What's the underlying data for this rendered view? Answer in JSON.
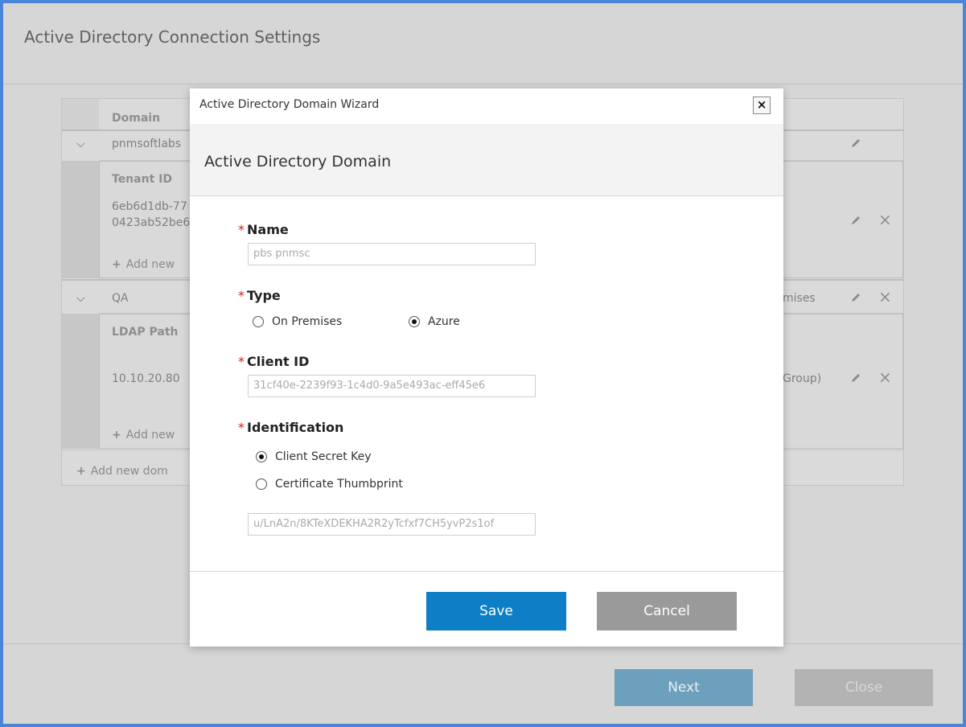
{
  "background": {
    "title": "Active Directory Connection Settings",
    "table": {
      "header_domain": "Domain",
      "row1_domain": "pnmsoftlabs",
      "row1_sub_header": "Tenant ID",
      "row1_tenant_line1": "6eb6d1db-77",
      "row1_tenant_line2": "0423ab52be6",
      "row1_add": "Add new",
      "row2_domain": "QA",
      "row2_type_partial": "mises",
      "row2_sub_header": "LDAP Path",
      "row2_ldap": "10.10.20.80",
      "row2_group_partial": "Group)",
      "row2_add": "Add new",
      "add_domain": "Add new dom"
    },
    "next_label": "Next",
    "close_label": "Close"
  },
  "modal": {
    "title": "Active Directory Domain Wizard",
    "close_glyph": "×",
    "subtitle": "Active Directory Domain",
    "name_label": "Name",
    "name_value": "pbs   pnmsc",
    "type_label": "Type",
    "type_options": [
      "On Premises",
      "Azure"
    ],
    "type_selected": "Azure",
    "client_id_label": "Client ID",
    "client_id_value": "31cf40e-2239f93-1c4d0-9a5e493ac-eff45e6",
    "identification_label": "Identification",
    "identification_options": [
      "Client Secret Key",
      "Certificate Thumbprint"
    ],
    "identification_selected": "Client Secret Key",
    "secret_value": "u/LnA2n/8KTeXDEKHA2R2yTcfxf7CH5yvP2s1of",
    "required_mark": "*",
    "save_label": "Save",
    "cancel_label": "Cancel"
  },
  "icons": {
    "expand": "chevron-down-icon",
    "edit": "pencil-icon",
    "delete": "x-icon",
    "add": "plus-icon"
  },
  "colors": {
    "primary": "#0e7fc6",
    "secondary": "#9a9a9a",
    "required": "#d21f1f",
    "frame": "#4a86d6"
  }
}
